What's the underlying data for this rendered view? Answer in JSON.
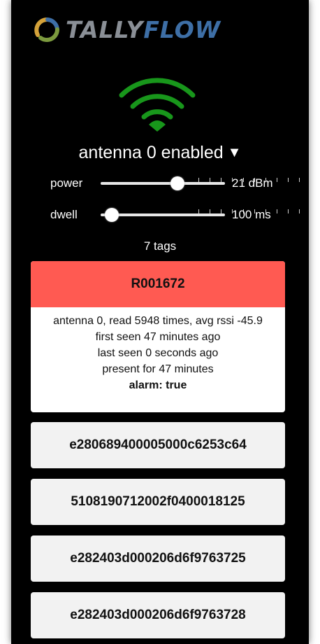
{
  "brand": {
    "part1": "TALLY",
    "part2": "FLOW"
  },
  "antenna": {
    "status": "antenna 0 enabled",
    "caret": "▼"
  },
  "power": {
    "label": "power",
    "value": "21 dBm",
    "level": 0.62
  },
  "dwell": {
    "label": "dwell",
    "value": "100 ms",
    "level": 0.09
  },
  "tag_count": "7 tags",
  "colors": {
    "alarm": "#ff5a52",
    "wifi": "#18961b"
  },
  "alarm_tag": {
    "id": "R001672",
    "line1": "antenna 0, read 5948 times, avg rssi -45.9",
    "line2": "first seen 47 minutes ago",
    "line3": "last seen 0 seconds ago",
    "line4": "present for 47 minutes",
    "line5": "alarm: true"
  },
  "tags": [
    "e280689400005000c6253c64",
    "5108190712002f0400018125",
    "e282403d000206d6f9763725",
    "e282403d000206d6f9763728"
  ]
}
